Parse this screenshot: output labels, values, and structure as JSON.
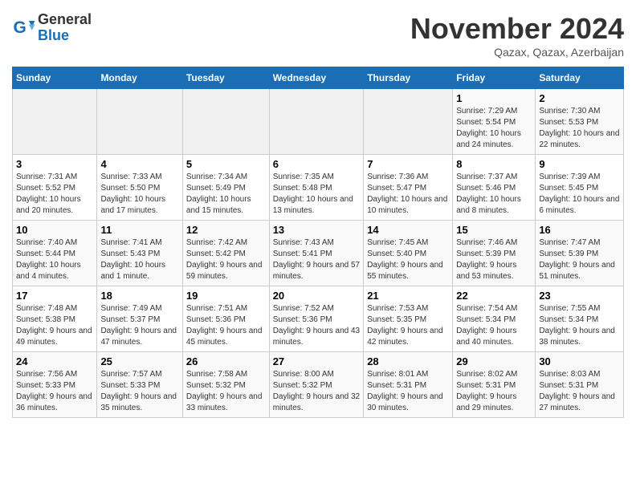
{
  "header": {
    "logo_line1": "General",
    "logo_line2": "Blue",
    "month": "November 2024",
    "location": "Qazax, Qazax, Azerbaijan"
  },
  "weekdays": [
    "Sunday",
    "Monday",
    "Tuesday",
    "Wednesday",
    "Thursday",
    "Friday",
    "Saturday"
  ],
  "weeks": [
    [
      {
        "day": "",
        "empty": true
      },
      {
        "day": "",
        "empty": true
      },
      {
        "day": "",
        "empty": true
      },
      {
        "day": "",
        "empty": true
      },
      {
        "day": "",
        "empty": true
      },
      {
        "day": "1",
        "sunrise": "7:29 AM",
        "sunset": "5:54 PM",
        "daylight": "10 hours and 24 minutes."
      },
      {
        "day": "2",
        "sunrise": "7:30 AM",
        "sunset": "5:53 PM",
        "daylight": "10 hours and 22 minutes."
      }
    ],
    [
      {
        "day": "3",
        "sunrise": "7:31 AM",
        "sunset": "5:52 PM",
        "daylight": "10 hours and 20 minutes."
      },
      {
        "day": "4",
        "sunrise": "7:33 AM",
        "sunset": "5:50 PM",
        "daylight": "10 hours and 17 minutes."
      },
      {
        "day": "5",
        "sunrise": "7:34 AM",
        "sunset": "5:49 PM",
        "daylight": "10 hours and 15 minutes."
      },
      {
        "day": "6",
        "sunrise": "7:35 AM",
        "sunset": "5:48 PM",
        "daylight": "10 hours and 13 minutes."
      },
      {
        "day": "7",
        "sunrise": "7:36 AM",
        "sunset": "5:47 PM",
        "daylight": "10 hours and 10 minutes."
      },
      {
        "day": "8",
        "sunrise": "7:37 AM",
        "sunset": "5:46 PM",
        "daylight": "10 hours and 8 minutes."
      },
      {
        "day": "9",
        "sunrise": "7:39 AM",
        "sunset": "5:45 PM",
        "daylight": "10 hours and 6 minutes."
      }
    ],
    [
      {
        "day": "10",
        "sunrise": "7:40 AM",
        "sunset": "5:44 PM",
        "daylight": "10 hours and 4 minutes."
      },
      {
        "day": "11",
        "sunrise": "7:41 AM",
        "sunset": "5:43 PM",
        "daylight": "10 hours and 1 minute."
      },
      {
        "day": "12",
        "sunrise": "7:42 AM",
        "sunset": "5:42 PM",
        "daylight": "9 hours and 59 minutes."
      },
      {
        "day": "13",
        "sunrise": "7:43 AM",
        "sunset": "5:41 PM",
        "daylight": "9 hours and 57 minutes."
      },
      {
        "day": "14",
        "sunrise": "7:45 AM",
        "sunset": "5:40 PM",
        "daylight": "9 hours and 55 minutes."
      },
      {
        "day": "15",
        "sunrise": "7:46 AM",
        "sunset": "5:39 PM",
        "daylight": "9 hours and 53 minutes."
      },
      {
        "day": "16",
        "sunrise": "7:47 AM",
        "sunset": "5:39 PM",
        "daylight": "9 hours and 51 minutes."
      }
    ],
    [
      {
        "day": "17",
        "sunrise": "7:48 AM",
        "sunset": "5:38 PM",
        "daylight": "9 hours and 49 minutes."
      },
      {
        "day": "18",
        "sunrise": "7:49 AM",
        "sunset": "5:37 PM",
        "daylight": "9 hours and 47 minutes."
      },
      {
        "day": "19",
        "sunrise": "7:51 AM",
        "sunset": "5:36 PM",
        "daylight": "9 hours and 45 minutes."
      },
      {
        "day": "20",
        "sunrise": "7:52 AM",
        "sunset": "5:36 PM",
        "daylight": "9 hours and 43 minutes."
      },
      {
        "day": "21",
        "sunrise": "7:53 AM",
        "sunset": "5:35 PM",
        "daylight": "9 hours and 42 minutes."
      },
      {
        "day": "22",
        "sunrise": "7:54 AM",
        "sunset": "5:34 PM",
        "daylight": "9 hours and 40 minutes."
      },
      {
        "day": "23",
        "sunrise": "7:55 AM",
        "sunset": "5:34 PM",
        "daylight": "9 hours and 38 minutes."
      }
    ],
    [
      {
        "day": "24",
        "sunrise": "7:56 AM",
        "sunset": "5:33 PM",
        "daylight": "9 hours and 36 minutes."
      },
      {
        "day": "25",
        "sunrise": "7:57 AM",
        "sunset": "5:33 PM",
        "daylight": "9 hours and 35 minutes."
      },
      {
        "day": "26",
        "sunrise": "7:58 AM",
        "sunset": "5:32 PM",
        "daylight": "9 hours and 33 minutes."
      },
      {
        "day": "27",
        "sunrise": "8:00 AM",
        "sunset": "5:32 PM",
        "daylight": "9 hours and 32 minutes."
      },
      {
        "day": "28",
        "sunrise": "8:01 AM",
        "sunset": "5:31 PM",
        "daylight": "9 hours and 30 minutes."
      },
      {
        "day": "29",
        "sunrise": "8:02 AM",
        "sunset": "5:31 PM",
        "daylight": "9 hours and 29 minutes."
      },
      {
        "day": "30",
        "sunrise": "8:03 AM",
        "sunset": "5:31 PM",
        "daylight": "9 hours and 27 minutes."
      }
    ]
  ]
}
